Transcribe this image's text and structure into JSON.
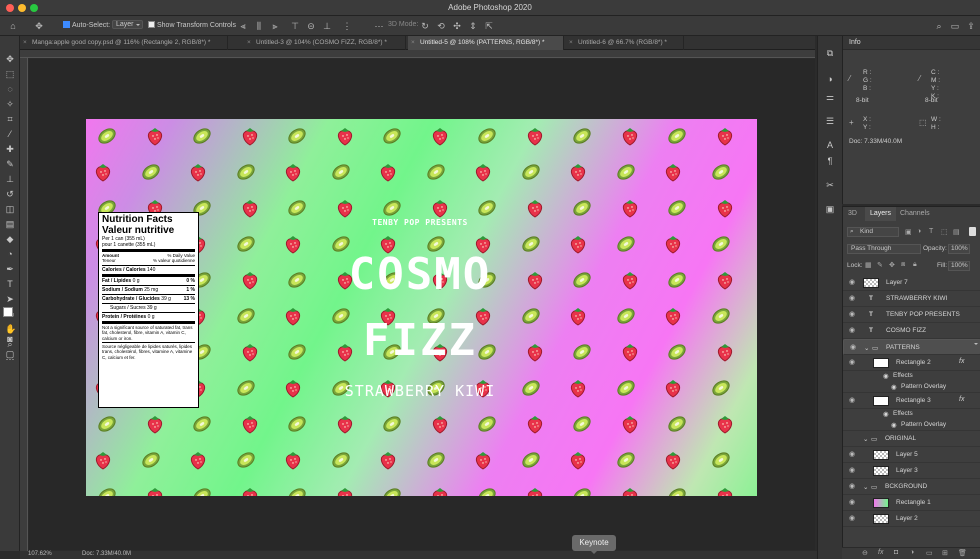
{
  "app": {
    "title": "Adobe Photoshop 2020"
  },
  "options_bar": {
    "auto_select_label": "Auto-Select:",
    "auto_select_value": "Layer",
    "transform_controls_label": "Show Transform Controls",
    "mode_3d_label": "3D Mode:"
  },
  "tabs": [
    {
      "label": "Manga:apple good copy.psd @ 116% (Rectangle 2, RGB/8*) *"
    },
    {
      "label": "Untitled-3 @ 104% (COSMO FIZZ, RGB/8*) *"
    },
    {
      "label": "Untitled-5 @ 108% (PATTERNS, RGB/8*) *"
    },
    {
      "label": "Untitled-6 @ 66.7% (RGB/8*) *"
    }
  ],
  "canvas": {
    "presenter": "TENBY POP PRESENTS",
    "title_line1": "COSMO",
    "title_line2": "FIZZ",
    "flavor": "STRAWBERRY KIWI",
    "nutrition": {
      "title_en": "Nutrition Facts",
      "title_fr": "Valeur nutritive",
      "serving_en": "Per 1 can (355 mL)",
      "serving_fr": "pour 1 canette (355 mL)",
      "amount": "Amount",
      "teneur": "Teneur",
      "dv_en": "% Daily Value",
      "dv_fr": "% valeur quotidienne",
      "calories_label": "Calories / Calories",
      "calories_value": "140",
      "fat_label": "Fat / Lipides",
      "fat_value": "0 g",
      "fat_dv": "0 %",
      "sodium_label": "Sodium / Sodium",
      "sodium_value": "25 mg",
      "sodium_dv": "1 %",
      "carb_label": "Carbohydrate / Glucides",
      "carb_value": "39 g",
      "carb_dv": "13 %",
      "sugars": "Sugars / Sucres 39 g",
      "protein_label": "Protein / Protéines",
      "protein_value": "0 g",
      "note_en": "Not a significant source of saturated fat, trans fat, cholesterol, fibre, vitamin A, vitamin C, calcium or iron.",
      "note_fr": "Source négligeable de lipides saturés, lipides trans, cholestérol, fibres, vitamine A, vitamine C, calcium et fer."
    }
  },
  "status": {
    "zoom": "107.62%",
    "doc": "Doc: 7.33M/40.0M"
  },
  "tooltip": "Keynote",
  "info_panel": {
    "title": "Info",
    "rgb": "R :\nG :\nB :",
    "cmyk": "C :\nM :\nY :\nK :",
    "bit1": "8-bit",
    "bit2": "8-bit",
    "xy": "X :\nY :",
    "wh": "W :\nH :",
    "doc": "Doc: 7.33M/40.0M"
  },
  "layers_panel": {
    "tabs": [
      "3D",
      "Layers",
      "Channels"
    ],
    "kind": "Kind",
    "blend": "Pass Through",
    "opacity_label": "Opacity:",
    "opacity": "100%",
    "lock_label": "Lock:",
    "fill_label": "Fill:",
    "fill": "100%",
    "layers": [
      {
        "name": "Layer 7"
      },
      {
        "name": "STRAWBERRY KIWI"
      },
      {
        "name": "TENBY POP PRESENTS"
      },
      {
        "name": "COSMO FIZZ"
      },
      {
        "name": "PATTERNS"
      },
      {
        "name": "Rectangle 2"
      },
      {
        "name": "Effects"
      },
      {
        "name": "Pattern Overlay"
      },
      {
        "name": "Rectangle 3"
      },
      {
        "name": "Effects"
      },
      {
        "name": "Pattern Overlay"
      },
      {
        "name": "ORIGINAL"
      },
      {
        "name": "Layer 5"
      },
      {
        "name": "Layer 3"
      },
      {
        "name": "BCKGROUND"
      },
      {
        "name": "Rectangle 1"
      },
      {
        "name": "Layer 2"
      }
    ]
  },
  "colors": {
    "accent": "#3d8bff",
    "artboard_pink": "#f177ee",
    "artboard_green": "#72f58b"
  }
}
